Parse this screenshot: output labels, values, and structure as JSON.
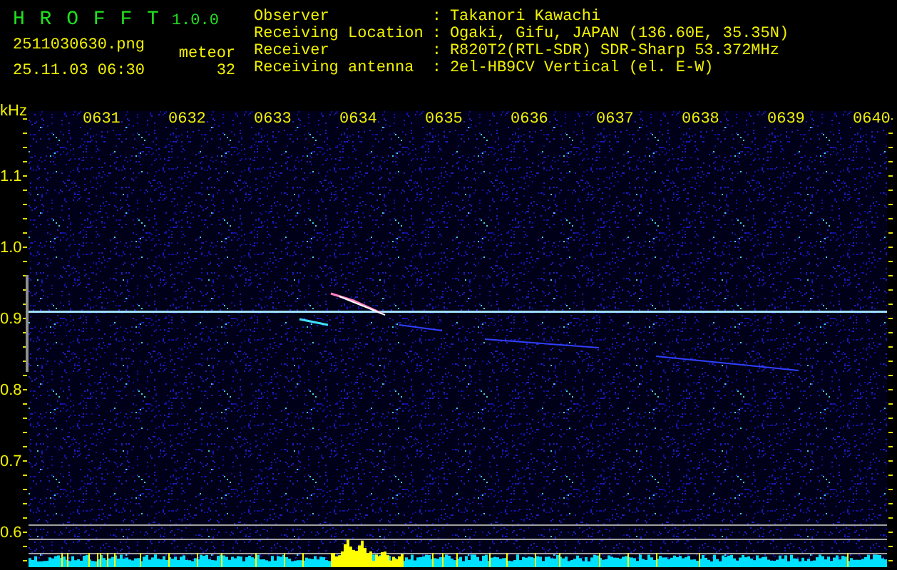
{
  "app": {
    "name": "H R O F F T",
    "version": "1.0.0"
  },
  "file": {
    "name": "2511030630.png",
    "timestamp": "25.11.03 06:30"
  },
  "meteor": {
    "label": "meteor",
    "count": "32"
  },
  "info": [
    {
      "label": "Observer",
      "separator": ":",
      "value": "Takanori Kawachi"
    },
    {
      "label": "Receiving Location",
      "separator": ":",
      "value": "Ogaki, Gifu, JAPAN (136.60E, 35.35N)"
    },
    {
      "label": "Receiver",
      "separator": ":",
      "value": "R820T2(RTL-SDR) SDR-Sharp 53.372MHz"
    },
    {
      "label": "Receiving antenna",
      "separator": ":",
      "value": "2el-HB9CV Vertical (el. E-W)"
    }
  ],
  "plot": {
    "unit": "kHz",
    "time_labels": [
      "0631",
      "0632",
      "0633",
      "0634",
      "0635",
      "0636",
      "0637",
      "0638",
      "0639",
      "0640"
    ],
    "freq_labels": [
      "1.1",
      "1.0",
      "0.9",
      "0.8",
      "0.7",
      "0.6"
    ]
  }
}
